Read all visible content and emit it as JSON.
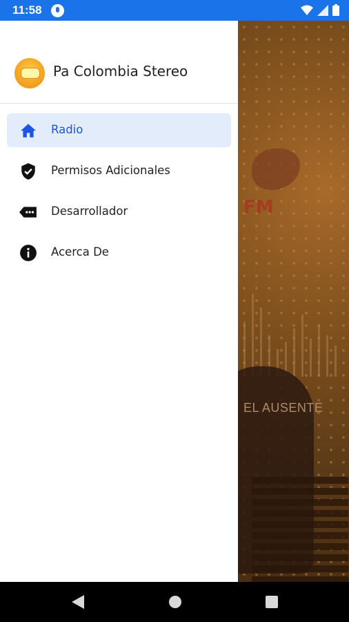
{
  "status_bar": {
    "time": "11:58"
  },
  "drawer": {
    "app_title": "Pa Colombia Stereo",
    "items": [
      {
        "label": "Radio",
        "icon": "home-icon",
        "active": true
      },
      {
        "label": "Permisos Adicionales",
        "icon": "shield-check-icon",
        "active": false
      },
      {
        "label": "Desarrollador",
        "icon": "label-more-icon",
        "active": false
      },
      {
        "label": "Acerca De",
        "icon": "info-icon",
        "active": false
      }
    ]
  },
  "background": {
    "song_title": "EL AUSENTE",
    "logo_text": "FM"
  },
  "colors": {
    "accent": "#1a55e3",
    "status_bar": "#1a73e8",
    "active_bg": "#e3ecfb"
  }
}
